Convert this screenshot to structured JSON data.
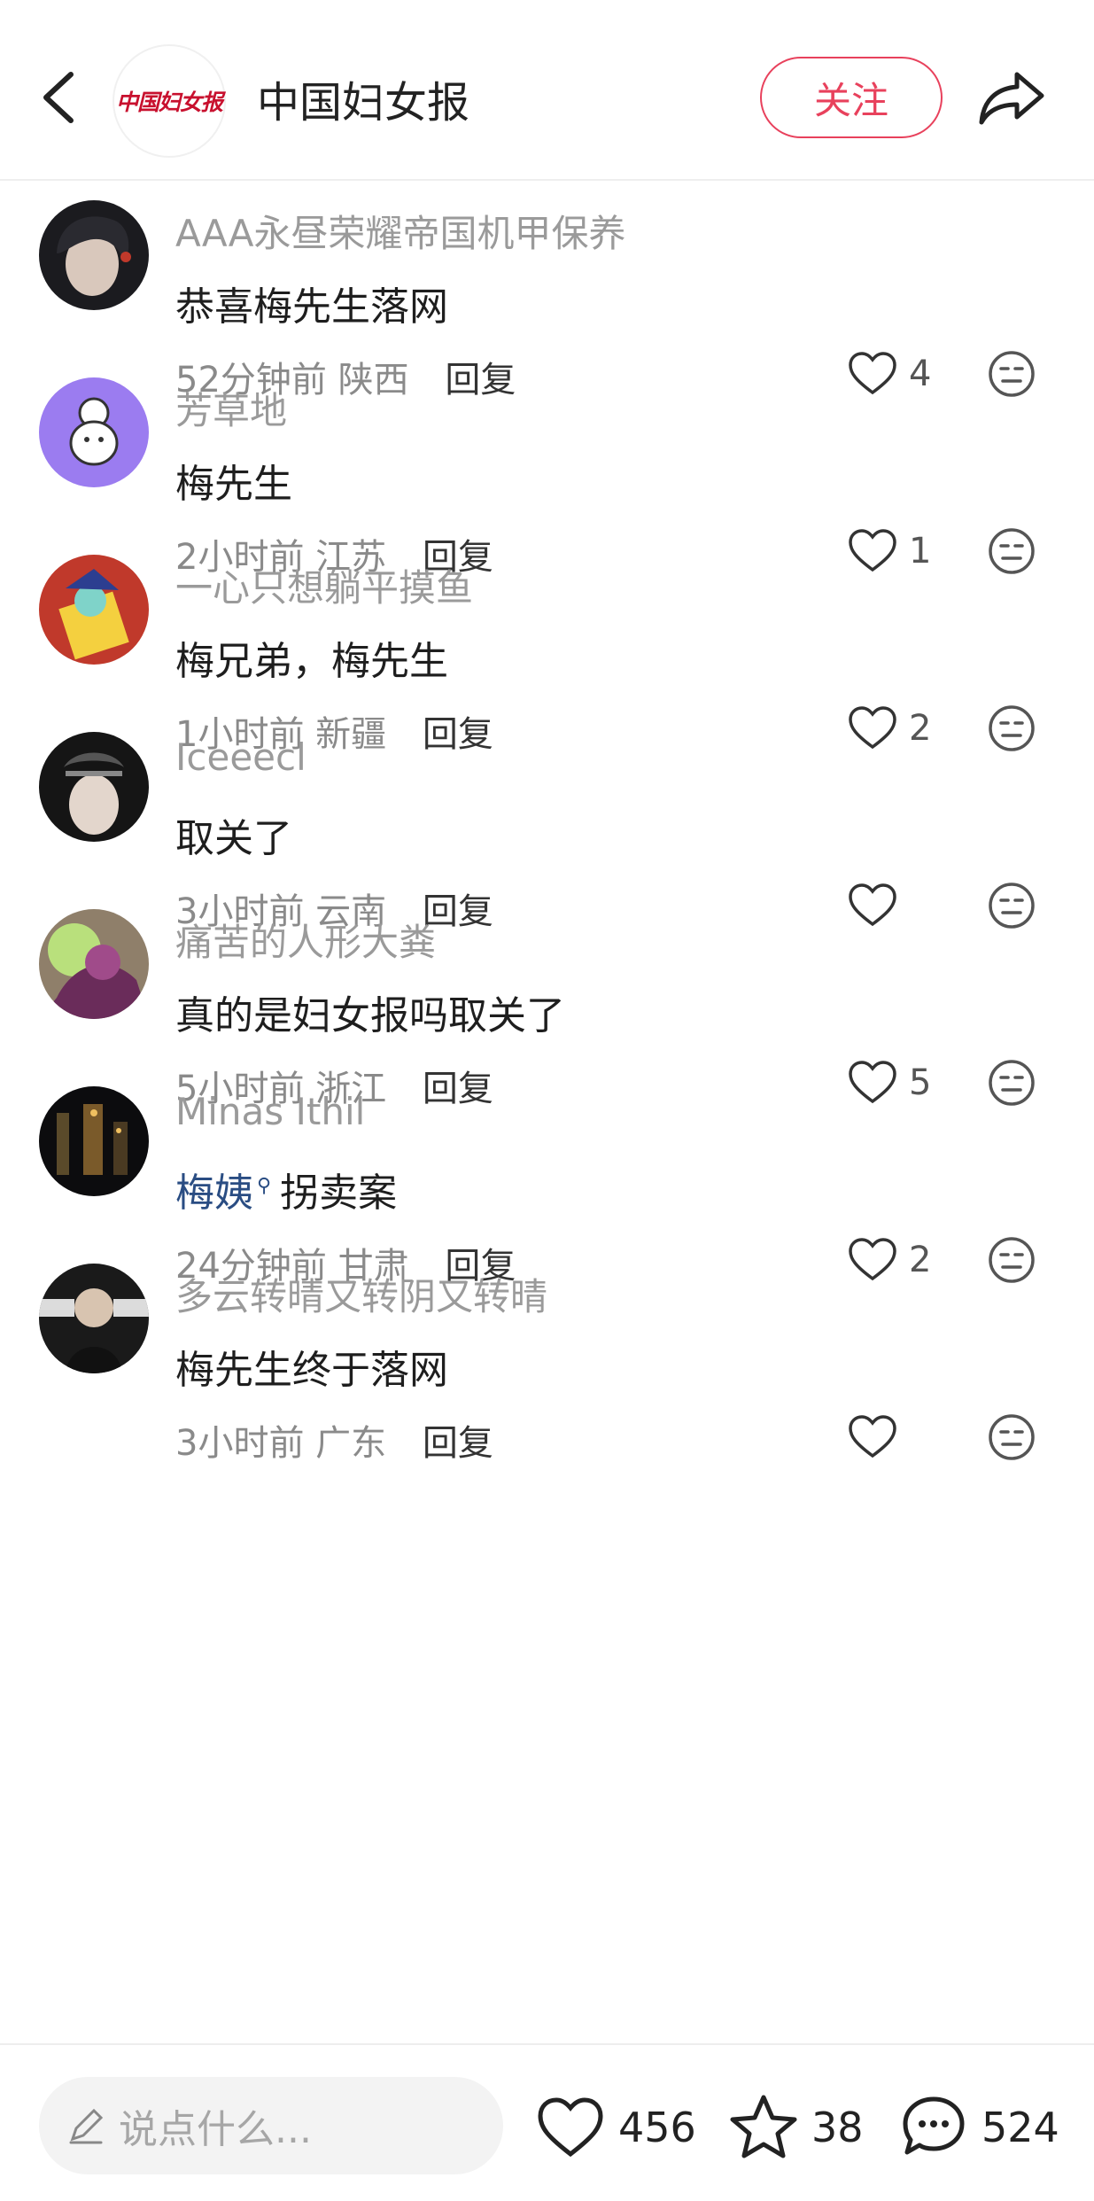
{
  "header": {
    "title": "中国妇女报",
    "logo_text": "中国妇女报",
    "follow_label": "关注"
  },
  "comments": [
    {
      "user": "AAA永昼荣耀帝国机甲保养",
      "text": "恭喜梅先生落网",
      "time": "52分钟前",
      "location": "陕西",
      "reply": "回复",
      "likes": "4"
    },
    {
      "user": "芳草地",
      "text": "梅先生",
      "time": "2小时前",
      "location": "江苏",
      "reply": "回复",
      "likes": "1"
    },
    {
      "user": "一心只想躺平摸鱼",
      "text": "梅兄弟，梅先生",
      "time": "1小时前",
      "location": "新疆",
      "reply": "回复",
      "likes": "2"
    },
    {
      "user": "Iceeecl",
      "text": "取关了",
      "time": "3小时前",
      "location": "云南",
      "reply": "回复",
      "likes": ""
    },
    {
      "user": "痛苦的人形大粪",
      "text": "真的是妇女报吗取关了",
      "time": "5小时前",
      "location": "浙江",
      "reply": "回复",
      "likes": "5"
    },
    {
      "user": "Minas Ithil",
      "text_link": "梅姨",
      "text_rest": "拐卖案",
      "time": "24分钟前",
      "location": "甘肃",
      "reply": "回复",
      "likes": "2"
    },
    {
      "user": "多云转晴又转阴又转晴",
      "text": "梅先生终于落网",
      "time": "3小时前",
      "location": "广东",
      "reply": "回复",
      "likes": ""
    }
  ],
  "bottom": {
    "input_placeholder": "说点什么...",
    "likes": "456",
    "stars": "38",
    "comments": "524"
  },
  "colors": {
    "accent": "#e8415c",
    "link": "#2a4d83",
    "meta": "#8a8a8a"
  }
}
